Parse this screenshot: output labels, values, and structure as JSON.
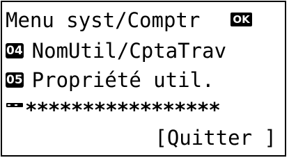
{
  "screen": {
    "title": "Menu syst/Comptr",
    "nav_icon": "four-way-arrow-icon",
    "ok_label": "OK",
    "items": [
      {
        "number": "04",
        "label": "NomUtil/CptaTrav"
      },
      {
        "number": "05",
        "label": "Propriété util."
      }
    ],
    "next_item_icon": "partial-next-item-icon",
    "password_mask": "*****************",
    "softkey_label": "[Quitter ]"
  }
}
